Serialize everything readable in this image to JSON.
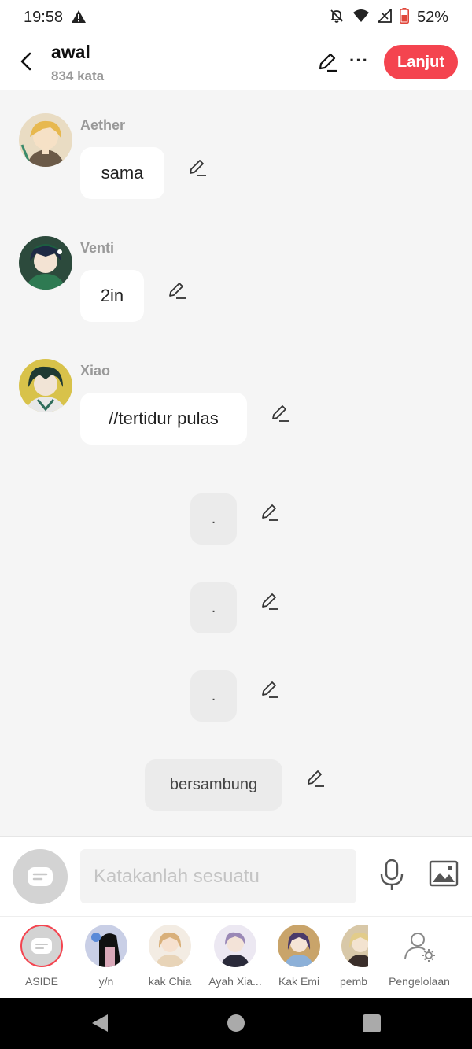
{
  "status": {
    "time": "19:58",
    "battery": "52%"
  },
  "header": {
    "title": "awal",
    "word_count": "834 kata",
    "next_label": "Lanjut"
  },
  "messages": [
    {
      "name": "Aether",
      "text": "sama"
    },
    {
      "name": "Venti",
      "text": "2in"
    },
    {
      "name": "Xiao",
      "text": "//tertidur pulas"
    }
  ],
  "narrations": [
    ".",
    ".",
    ".",
    "bersambung"
  ],
  "input": {
    "placeholder": "Katakanlah sesuatu"
  },
  "characters": [
    {
      "label": "ASIDE"
    },
    {
      "label": "y/n"
    },
    {
      "label": "kak Chia"
    },
    {
      "label": "Ayah Xia..."
    },
    {
      "label": "Kak Emi"
    },
    {
      "label": "pemb"
    },
    {
      "label": "Pengelolaan"
    }
  ],
  "colors": {
    "accent": "#f4444f",
    "bubble": "#ffffff",
    "narration_bubble": "#ebebeb",
    "background": "#f5f5f5"
  }
}
